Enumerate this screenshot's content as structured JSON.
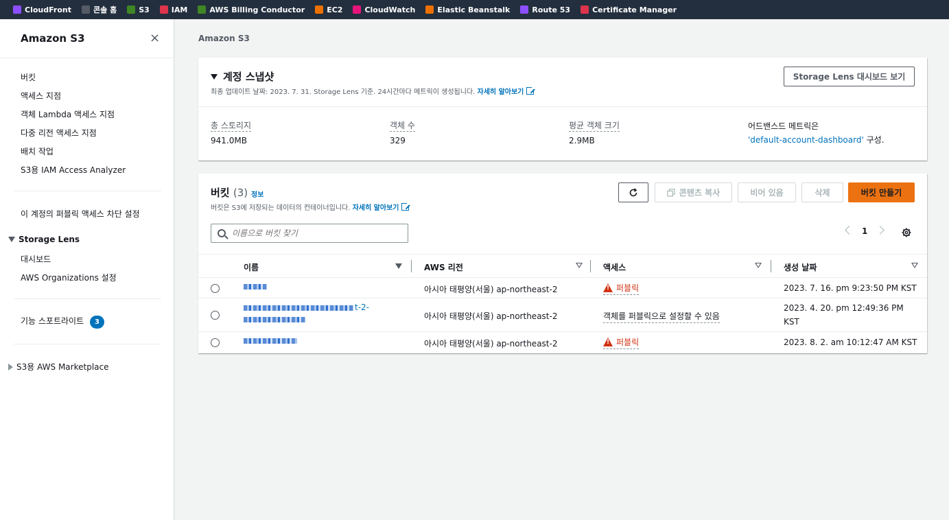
{
  "favorites": [
    {
      "label": "CloudFront",
      "color": "#8c4fff"
    },
    {
      "label": "콘솔 홈",
      "color": "#545b64"
    },
    {
      "label": "S3",
      "color": "#3f8624"
    },
    {
      "label": "IAM",
      "color": "#dd344c"
    },
    {
      "label": "AWS Billing Conductor",
      "color": "#3f8624"
    },
    {
      "label": "EC2",
      "color": "#ed7100"
    },
    {
      "label": "CloudWatch",
      "color": "#e7157b"
    },
    {
      "label": "Elastic Beanstalk",
      "color": "#ed7100"
    },
    {
      "label": "Route 53",
      "color": "#8c4fff"
    },
    {
      "label": "Certificate Manager",
      "color": "#dd344c"
    }
  ],
  "sidebar": {
    "title": "Amazon S3",
    "close_icon": "×",
    "items": [
      "버킷",
      "액세스 지점",
      "객체 Lambda 액세스 지점",
      "다중 리전 액세스 지점",
      "배치 작업",
      "S3용 IAM Access Analyzer"
    ],
    "block_public": "이 계정의 퍼블릭 액세스 차단 설정",
    "storage_lens": {
      "label": "Storage Lens",
      "items": [
        "대시보드",
        "AWS Organizations 설정"
      ]
    },
    "feature_spotlight": {
      "label": "기능 스포트라이트",
      "badge": "3"
    },
    "marketplace": "S3용 AWS Marketplace"
  },
  "breadcrumb": "Amazon S3",
  "snapshot": {
    "title": "계정 스냅샷",
    "desc": "최종 업데이트 날짜: 2023. 7. 31. Storage Lens 기준. 24시간마다 메트릭이 생성됩니다.",
    "learn_more": "자세히 알아보기",
    "dashboard_button": "Storage Lens 대시보드 보기",
    "metrics": [
      {
        "label": "총 스토리지",
        "value": "941.0MB"
      },
      {
        "label": "객체 수",
        "value": "329"
      },
      {
        "label": "평균 객체 크기",
        "value": "2.9MB"
      }
    ],
    "advanced_prefix": "어드밴스드 메트릭은",
    "advanced_link": "'default-account-dashboard'",
    "advanced_suffix": " 구성."
  },
  "buckets": {
    "title": "버킷",
    "count": "(3)",
    "info": "정보",
    "desc": "버킷은 S3에 저장되는 데이터의 컨테이너입니다.",
    "learn_more": "자세히 알아보기",
    "buttons": {
      "copy_arn": "콘텐츠 복사",
      "empty": "비어 있음",
      "delete": "삭제",
      "create": "버킷 만들기"
    },
    "search_placeholder": "이름으로 버킷 찾기",
    "page": "1",
    "columns": [
      "이름",
      "AWS 리전",
      "액세스",
      "생성 날짜"
    ],
    "rows": [
      {
        "region": "아시아 태평양(서울) ap-northeast-2",
        "access": "퍼블릭",
        "created": "2023. 7. 16. pm 9:23:50 PM KST",
        "public": true
      },
      {
        "name_suffix": "t-2-",
        "region": "아시아 태평양(서울) ap-northeast-2",
        "access": "객체를 퍼블릭으로 설정할 수 있음",
        "created_line1": "2023. 4. 20. pm 12:49:36 PM",
        "created_line2": "KST",
        "public": false
      },
      {
        "region": "아시아 태평양(서울) ap-northeast-2",
        "access": "퍼블릭",
        "created": "2023. 8. 2. am 10:12:47 AM KST",
        "public": true
      }
    ]
  }
}
